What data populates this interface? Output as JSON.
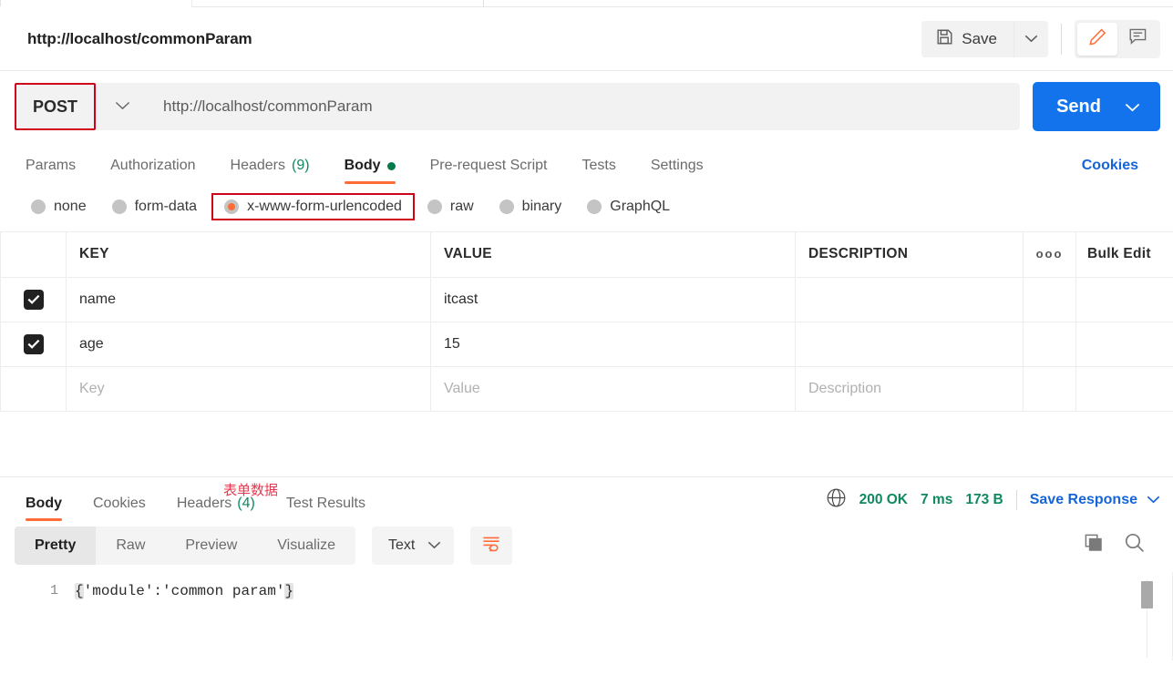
{
  "request": {
    "title": "http://localhost/commonParam",
    "method": "POST",
    "url": "http://localhost/commonParam",
    "send_label": "Send",
    "save_label": "Save",
    "save_icon": "floppy-disk-icon",
    "edit_icon": "pencil-icon",
    "comment_icon": "comment-icon",
    "method_caret_icon": "chevron-down-icon",
    "accent_orange": "#ff6c37",
    "accent_blue": "#1273ec",
    "annotation_red": "#d0021b"
  },
  "request_tabs": {
    "items": [
      {
        "label": "Params",
        "active": false
      },
      {
        "label": "Authorization",
        "active": false
      },
      {
        "label": "Headers",
        "count": "(9)",
        "active": false
      },
      {
        "label": "Body",
        "active": true,
        "dot": true
      },
      {
        "label": "Pre-request Script",
        "active": false
      },
      {
        "label": "Tests",
        "active": false
      },
      {
        "label": "Settings",
        "active": false
      }
    ],
    "cookies_link": "Cookies"
  },
  "body_types": {
    "options": [
      {
        "label": "none",
        "selected": false,
        "boxed": false
      },
      {
        "label": "form-data",
        "selected": false,
        "boxed": false
      },
      {
        "label": "x-www-form-urlencoded",
        "selected": true,
        "boxed": true
      },
      {
        "label": "raw",
        "selected": false,
        "boxed": false
      },
      {
        "label": "binary",
        "selected": false,
        "boxed": false
      },
      {
        "label": "GraphQL",
        "selected": false,
        "boxed": false
      }
    ]
  },
  "params_table": {
    "annotation": "表单数据",
    "headers": {
      "key": "KEY",
      "value": "VALUE",
      "description": "DESCRIPTION",
      "dots": "ooo",
      "bulk_edit": "Bulk Edit"
    },
    "rows": [
      {
        "checked": true,
        "key": "name",
        "value": "itcast",
        "description": ""
      },
      {
        "checked": true,
        "key": "age",
        "value": "15",
        "description": ""
      }
    ],
    "placeholder_row": {
      "key": "Key",
      "value": "Value",
      "description": "Description"
    }
  },
  "response": {
    "tabs": [
      {
        "label": "Body",
        "active": true
      },
      {
        "label": "Cookies",
        "active": false
      },
      {
        "label": "Headers",
        "count": "(4)",
        "active": false
      },
      {
        "label": "Test Results",
        "active": false
      }
    ],
    "status": "200 OK",
    "time": "7 ms",
    "size": "173 B",
    "globe_icon": "globe-icon",
    "save_response_label": "Save Response",
    "save_response_caret": "chevron-down-icon",
    "viewer": {
      "modes": [
        {
          "label": "Pretty",
          "active": true
        },
        {
          "label": "Raw",
          "active": false
        },
        {
          "label": "Preview",
          "active": false
        },
        {
          "label": "Visualize",
          "active": false
        }
      ],
      "format": "Text",
      "format_caret": "chevron-down-icon",
      "wrap_icon": "word-wrap-icon",
      "copy_icon": "copy-icon",
      "search_icon": "search-icon"
    },
    "code": {
      "line_number": "1",
      "open_brace": "{",
      "content": "'module':'common param'",
      "close_brace": "}"
    }
  }
}
